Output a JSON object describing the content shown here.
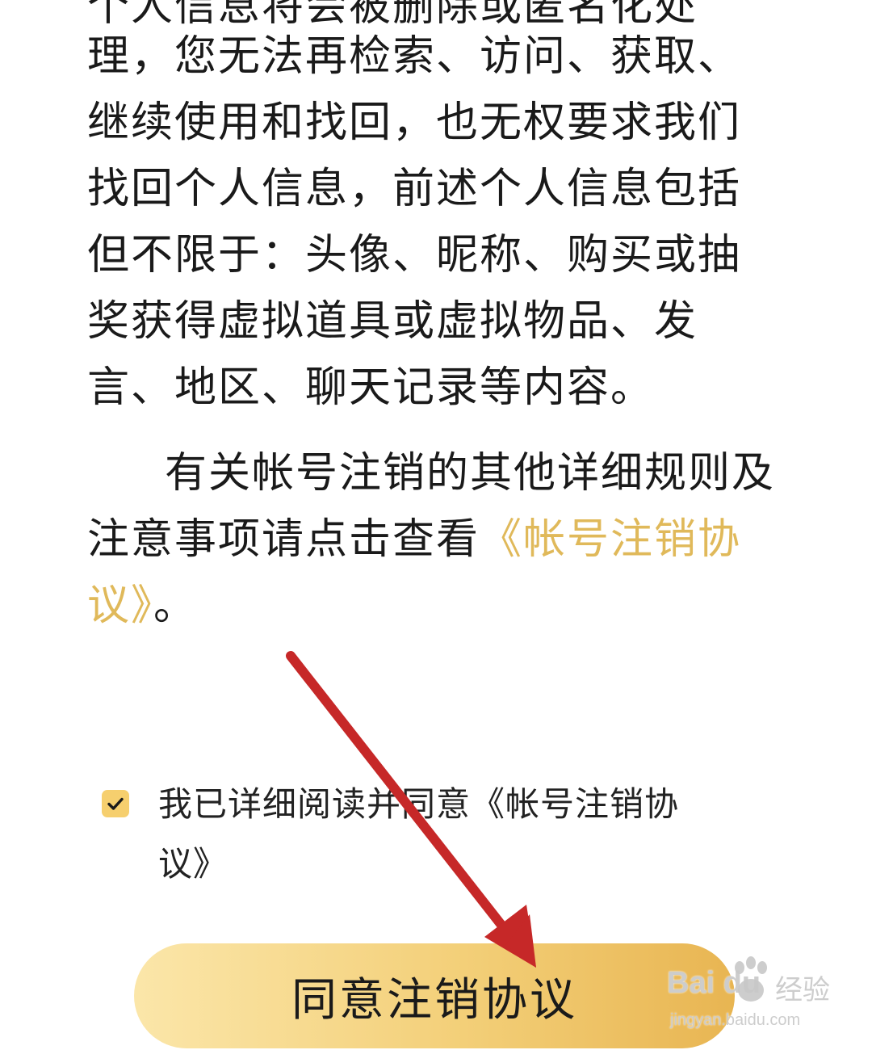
{
  "article": {
    "lines": [
      "个人信息将会被删除或匿名化处",
      "理，您无法再检索、访问、获取、",
      "继续使用和找回，也无权要求我们",
      "找回个人信息，前述个人信息包括",
      "但不限于：头像、昵称、购买或抽",
      "奖获得虚拟道具或虚拟物品、发",
      "言、地区、聊天记录等内容。"
    ],
    "para2_line1": "有关帐号注销的其他详细规则及",
    "para2_line2_prefix": "注意事项请点击查看",
    "agreement_link_part1": "《帐号注销协",
    "agreement_link_part2": "议》",
    "para2_tail": "。"
  },
  "consent": {
    "checked": true,
    "line1": "我已详细阅读并同意《帐号注销协",
    "line2": "议》"
  },
  "cta": {
    "label": "同意注销协议"
  },
  "watermark": {
    "brand": "Bai  du",
    "jingyan": "经验",
    "url": "jingyan.baidu.com"
  },
  "colors": {
    "link": "#e0b95a",
    "checkbox": "#f6cf6e",
    "button_gradient_start": "#fbe6a9",
    "button_gradient_end": "#e8b552",
    "arrow": "#c62828"
  }
}
